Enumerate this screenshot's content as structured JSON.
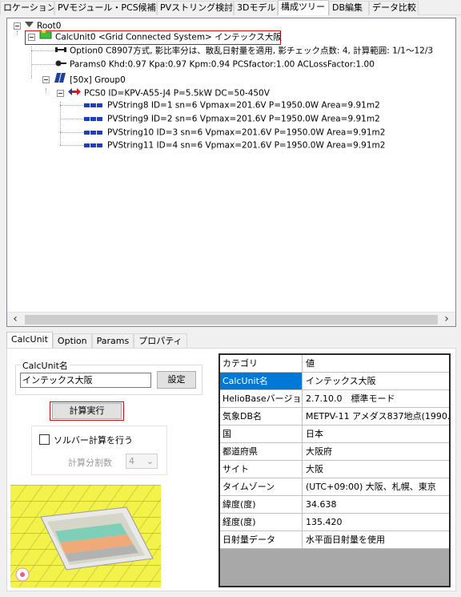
{
  "top_tabs": [
    {
      "label": "ロケーション"
    },
    {
      "label": "PVモジュール・PCS候補"
    },
    {
      "label": "PVストリング検討"
    },
    {
      "label": "3Dモデル"
    },
    {
      "label": "構成ツリー"
    },
    {
      "label": "DB編集"
    },
    {
      "label": "データ比較"
    }
  ],
  "tree": {
    "root": "Root0",
    "calcunit": "CalcUnit0 <Grid Connected System> インテックス大阪",
    "option": "Option0 C8907方式, 影比率分は、散乱日射量を適用, 影チェック点数: 4, 計算範囲: 1/1～12/3",
    "params": "Params0 Khd:0.97 Kpa:0.97 Kpm:0.94 PCSfactor:1.00 ACLossFactor:1.00",
    "group": "[50x] Group0",
    "pcs": "PCS0 ID=KPV-A55-J4 P=5.5kW DC=50-450V",
    "strings": [
      "PVString8 ID=1 sn=6 Vpmax=201.6V P=1950.0W Area=9.91m2",
      "PVString9 ID=2 sn=6 Vpmax=201.6V P=1950.0W Area=9.91m2",
      "PVString10 ID=3 sn=6 Vpmax=201.6V P=1950.0W Area=9.91m2",
      "PVString11 ID=4 sn=6 Vpmax=201.6V P=1950.0W Area=9.91m2"
    ]
  },
  "bottom_tabs": [
    {
      "label": "CalcUnit"
    },
    {
      "label": "Option"
    },
    {
      "label": "Params"
    },
    {
      "label": "プロパティ"
    }
  ],
  "calcunit_panel": {
    "name_label": "CalcUnit名",
    "name_value": "インテックス大阪",
    "set_button": "設定",
    "run_button": "計算実行",
    "solver_checkbox": "ソルバー計算を行う",
    "split_label": "計算分割数",
    "split_value": "4"
  },
  "properties": {
    "header": {
      "key": "カテゴリ",
      "value": "値"
    },
    "rows": [
      {
        "key": "CalcUnit名",
        "value": "インテックス大阪"
      },
      {
        "key": "HelioBaseバージョ...",
        "value": "2.7.10.0　標準モード"
      },
      {
        "key": "気象DB名",
        "value": "METPV-11 アメダス837地点(1990..."
      },
      {
        "key": "国",
        "value": "日本"
      },
      {
        "key": "都道府県",
        "value": "大阪府"
      },
      {
        "key": "サイト",
        "value": "大阪"
      },
      {
        "key": "タイムゾーン",
        "value": "(UTC+09:00) 大阪、札幌、東京"
      },
      {
        "key": "緯度(度)",
        "value": "34.638"
      },
      {
        "key": "経度(度)",
        "value": "135.420"
      },
      {
        "key": "日射量データ",
        "value": "水平面日射量を使用"
      }
    ]
  },
  "colors": {
    "selection_blue": "#0078d7",
    "highlight_red": "#d01010",
    "preview_yellow": "#f2f24a"
  }
}
